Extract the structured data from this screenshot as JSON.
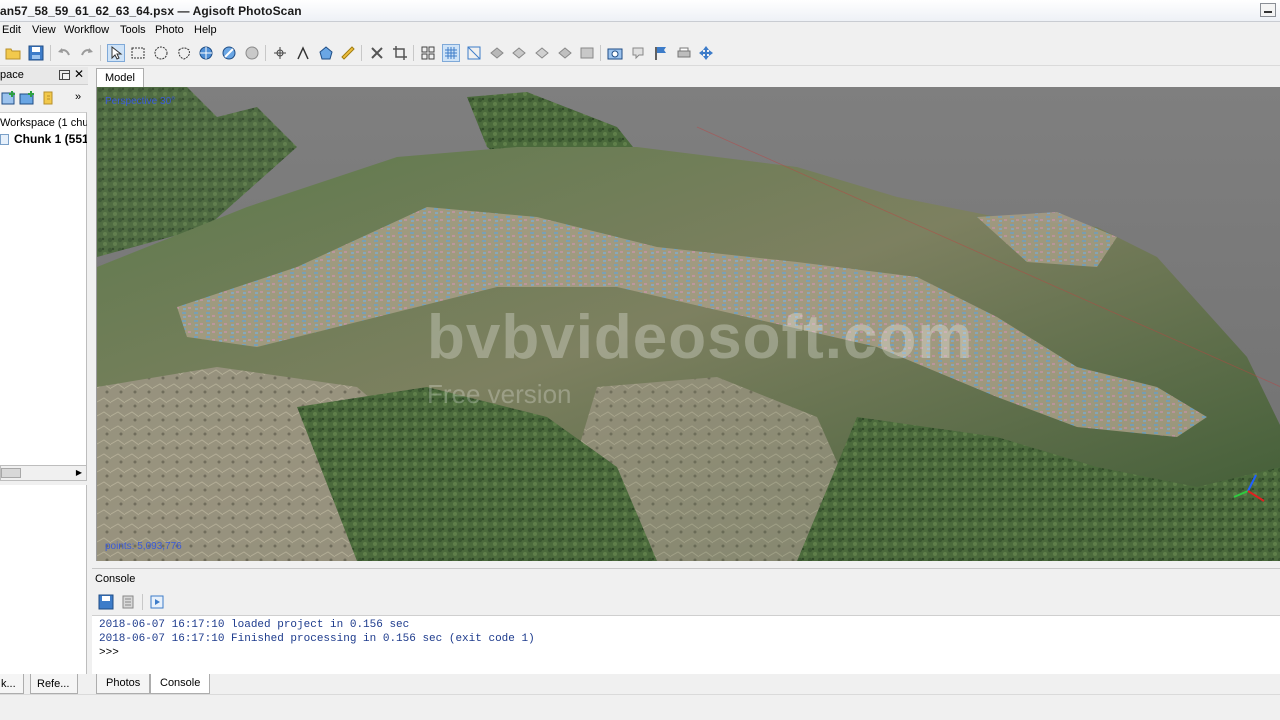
{
  "window": {
    "title": "an57_58_59_61_62_63_64.psx — Agisoft PhotoScan"
  },
  "menu": {
    "items": [
      "Edit",
      "View",
      "Workflow",
      "Tools",
      "Photo",
      "Help"
    ]
  },
  "toolbar": {
    "icons": [
      "open-icon",
      "save-icon",
      "undo-icon",
      "redo-icon",
      "navigation-icon",
      "rectangle-selection-icon",
      "circle-selection-icon",
      "free-form-selection-icon",
      "rotate-object-icon",
      "move-object-icon",
      "resize-region-icon",
      "ruler-icon",
      "delete-icon",
      "crop-icon",
      "show-cameras-icon",
      "grid-icon",
      "align-icon",
      "view-icons",
      "screenshot-icon",
      "marker-icon",
      "flag-icon",
      "printer-icon",
      "navigate-icon"
    ]
  },
  "workspace": {
    "title": "pace",
    "root_label": "Workspace (1 chun",
    "chunk_label": "Chunk 1 (551",
    "tabs": [
      "k...",
      "Refe..."
    ]
  },
  "model": {
    "tab_label": "Model",
    "perspective_label": "Perspective 30°",
    "points_label": "points: 5,093,776",
    "watermark": "bvbvideosoft.com",
    "watermark_sub": "Free version"
  },
  "console": {
    "title": "Console",
    "lines": [
      "2018-06-07 16:17:10 loaded project in 0.156 sec",
      "2018-06-07 16:17:10 Finished processing in 0.156 sec (exit code 1)"
    ],
    "prompt": ">>>"
  },
  "bottom_tabs": [
    "Photos",
    "Console"
  ],
  "colors": {
    "accent": "#3a5ad8",
    "console_text": "#1c3a8c",
    "terrain_green": "#4f6d3f",
    "terrain_rock": "#a59e8b"
  }
}
